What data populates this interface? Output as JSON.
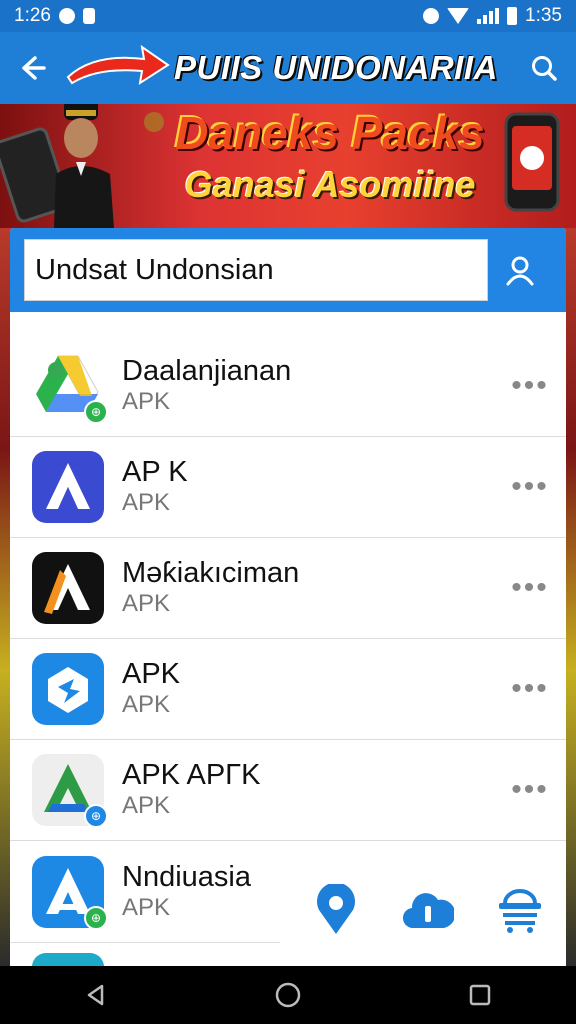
{
  "status_bar": {
    "time_left": "1:26",
    "time_right": "1:35",
    "icons": [
      "notification-icon",
      "notification-icon",
      "alarm-icon",
      "wifi-icon",
      "signal-icon",
      "battery-icon"
    ]
  },
  "app_bar": {
    "title": "PUIIS UNIDONARIIA",
    "icons": [
      "back-arrow-icon",
      "red-arrow-decoration",
      "search-icon"
    ]
  },
  "banner": {
    "line1": "Daneks Packs",
    "line2": "Ganasi Asomiine"
  },
  "search": {
    "value": "Undsat Undonsian",
    "account_icon": "person-icon"
  },
  "apps": [
    {
      "name": "Daalanjianan",
      "type": "APK",
      "icon": "drive-icon"
    },
    {
      "name": "AP K",
      "type": "APK",
      "icon": "blue-a-icon"
    },
    {
      "name": "Məƙiakıciman",
      "type": "APK",
      "icon": "black-a-icon"
    },
    {
      "name": "APK",
      "type": "APK",
      "icon": "blue-box-icon"
    },
    {
      "name": "APK APΓK",
      "type": "APK",
      "icon": "green-a-icon"
    },
    {
      "name": "Nndiuasia",
      "type": "APK",
      "icon": "white-a-icon"
    }
  ],
  "more_label": "•••",
  "bottom_actions": [
    "location-pin-icon",
    "cloud-info-icon",
    "basket-icon"
  ],
  "nav": [
    "nav-back-icon",
    "nav-home-icon",
    "nav-recents-icon"
  ],
  "colors": {
    "primary": "#1f7fd6",
    "search_bar": "#2285e3",
    "banner_red": "#e8402f",
    "banner_yellow": "#ffd33a"
  }
}
